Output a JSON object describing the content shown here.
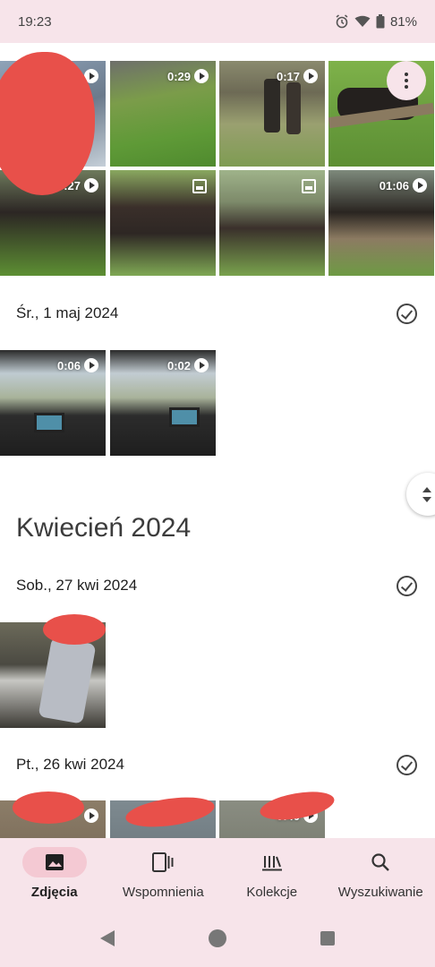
{
  "status_bar": {
    "time": "19:23",
    "battery": "81%",
    "icons": [
      "alarm-icon",
      "wifi-icon",
      "battery-icon"
    ]
  },
  "grid_top": {
    "durations": [
      "0:29",
      "0:17",
      ":27",
      "01:06"
    ]
  },
  "sections": [
    {
      "date": "Śr., 1 maj 2024",
      "durations": [
        "0:06",
        "0:02"
      ]
    }
  ],
  "month_heading": "Kwiecień 2024",
  "april_sections": [
    {
      "date": "Sob., 27 kwi 2024"
    },
    {
      "date": "Pt., 26 kwi 2024",
      "durations": [
        "0:40"
      ]
    }
  ],
  "bottom_nav": {
    "items": [
      {
        "label": "Zdjęcia",
        "icon": "photo-icon",
        "active": true
      },
      {
        "label": "Wspomnienia",
        "icon": "memories-icon",
        "active": false
      },
      {
        "label": "Kolekcje",
        "icon": "collections-icon",
        "active": false
      },
      {
        "label": "Wyszukiwanie",
        "icon": "search-icon",
        "active": false
      }
    ]
  },
  "colors": {
    "accent_bg": "#f7e4ea",
    "active_pill": "#f4c9d3",
    "redaction": "#e8504a"
  }
}
